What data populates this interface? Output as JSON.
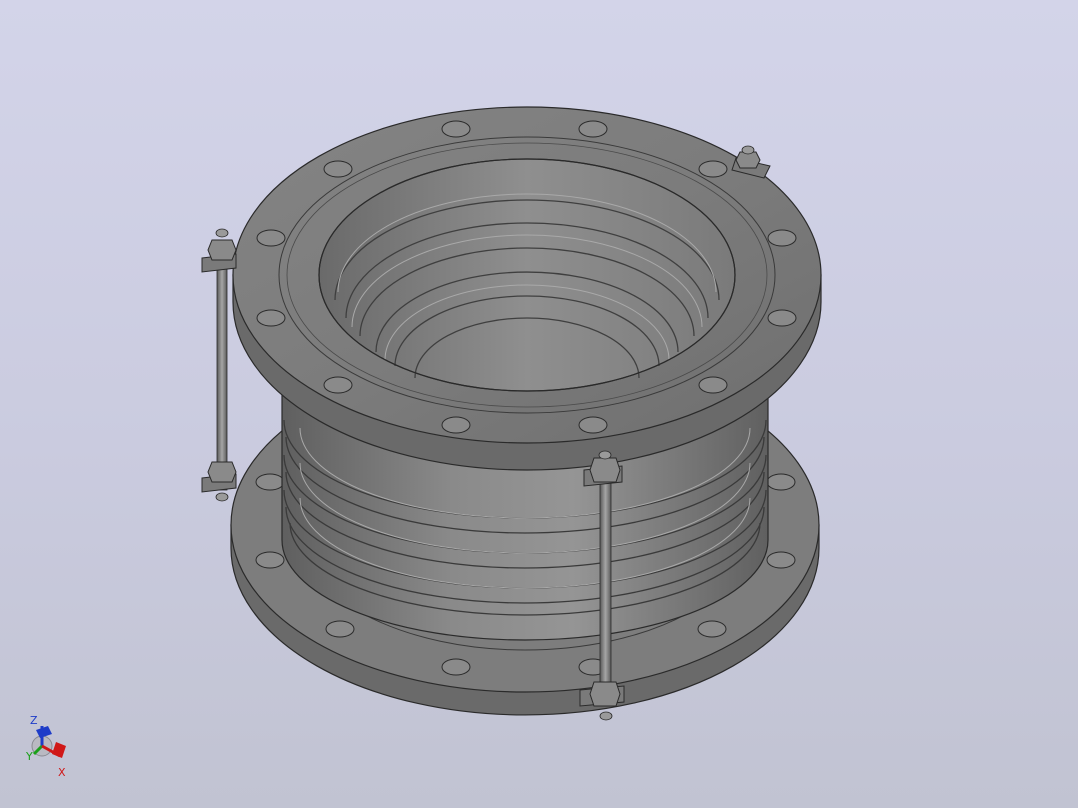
{
  "viewport": {
    "background_top": "#d3d4e9",
    "background_bottom": "#c1c3d2",
    "model": "flanged-bellows-expansion-joint",
    "model_color": "#7a7a7a"
  },
  "triad": {
    "z_label": "Z",
    "y_label": "Y",
    "x_label": "X",
    "z_color": "#1e3cc8",
    "y_color": "#1aa01a",
    "x_color": "#d01818"
  }
}
